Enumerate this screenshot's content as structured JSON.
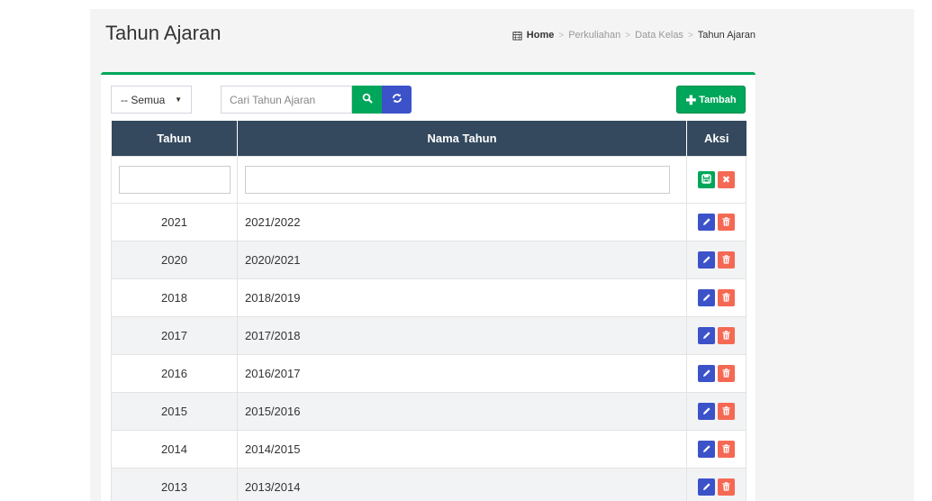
{
  "header": {
    "title": "Tahun Ajaran",
    "breadcrumb": {
      "home": "Home",
      "items": [
        "Perkuliahan",
        "Data Kelas"
      ],
      "active": "Tahun Ajaran",
      "separator": ">"
    }
  },
  "toolbar": {
    "filter_value": "-- Semua",
    "search_placeholder": "Cari Tahun Ajaran",
    "add_label": "Tambah"
  },
  "table": {
    "columns": [
      "Tahun",
      "Nama Tahun",
      "Aksi"
    ],
    "rows": [
      {
        "tahun": "2021",
        "nama": "2021/2022"
      },
      {
        "tahun": "2020",
        "nama": "2020/2021"
      },
      {
        "tahun": "2018",
        "nama": "2018/2019"
      },
      {
        "tahun": "2017",
        "nama": "2017/2018"
      },
      {
        "tahun": "2016",
        "nama": "2016/2017"
      },
      {
        "tahun": "2015",
        "nama": "2015/2016"
      },
      {
        "tahun": "2014",
        "nama": "2014/2015"
      },
      {
        "tahun": "2013",
        "nama": "2013/2014"
      }
    ]
  },
  "colors": {
    "accent_green": "#00a65a",
    "accent_blue": "#3c52c9",
    "danger_red": "#f56954",
    "table_header": "#34495e"
  },
  "icons": {
    "breadcrumb": "calendar-icon",
    "search": "search-icon",
    "refresh": "refresh-icon",
    "add": "plus-icon",
    "save": "save-icon",
    "cancel": "close-icon",
    "edit": "pencil-icon",
    "delete": "trash-icon"
  }
}
